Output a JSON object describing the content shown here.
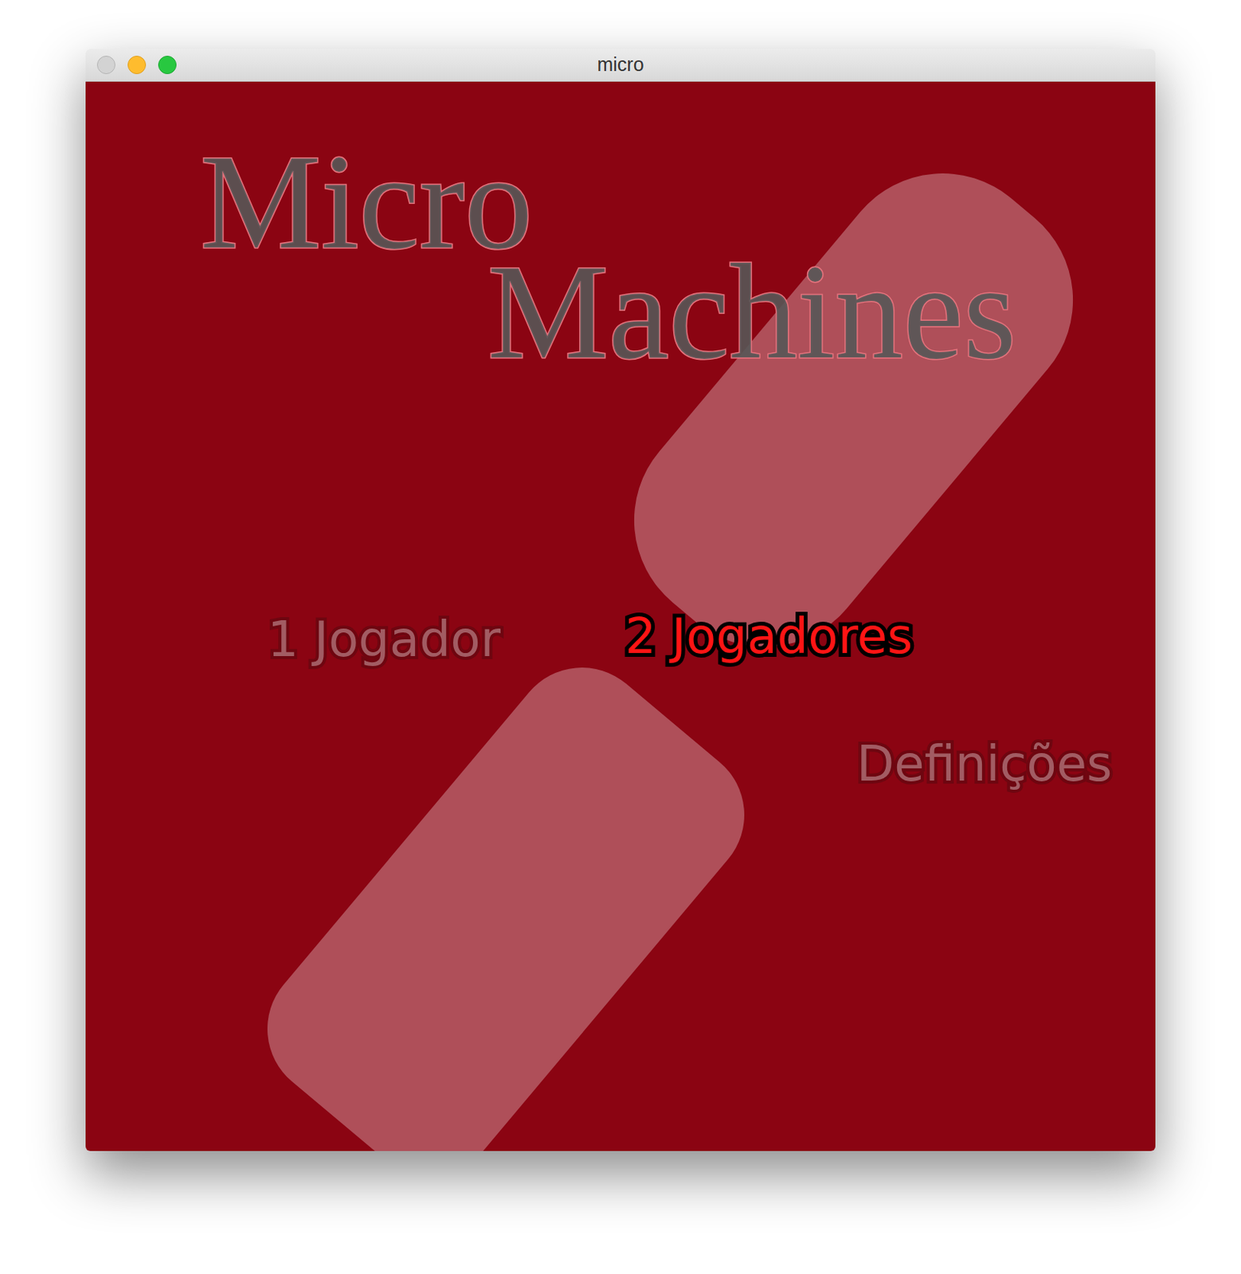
{
  "window": {
    "title": "micro"
  },
  "title_lines": [
    "Micro",
    "Machines"
  ],
  "menu": [
    {
      "label": "1 Jogador",
      "selected": false
    },
    {
      "label": "2 Jogadores",
      "selected": true
    },
    {
      "label": "Definições",
      "selected": false
    }
  ]
}
